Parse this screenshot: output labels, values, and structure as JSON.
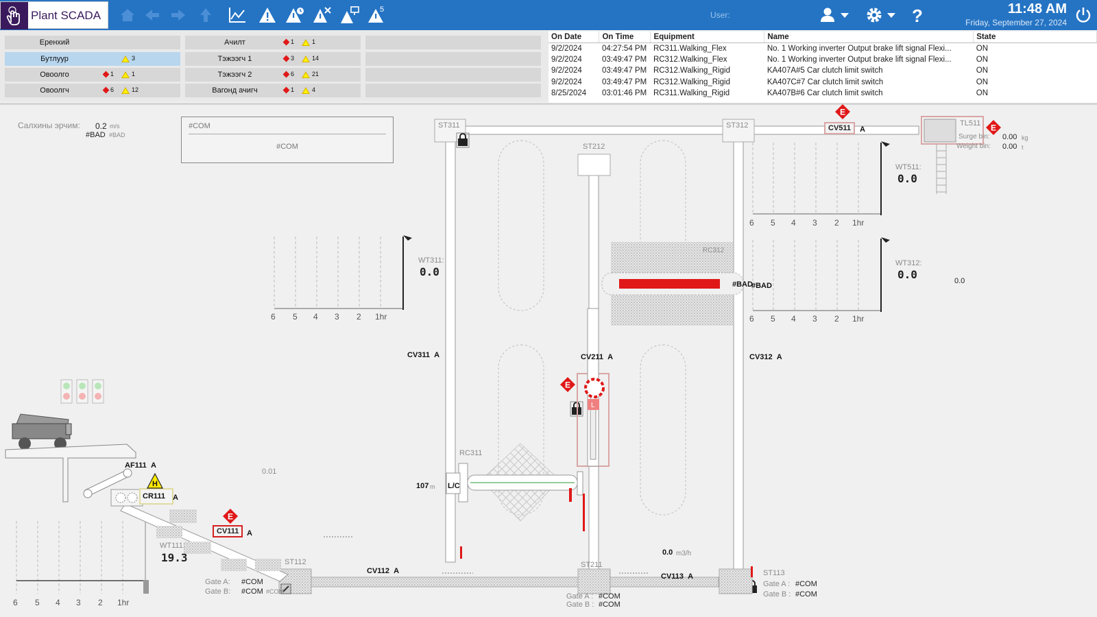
{
  "header": {
    "app_title": "Plant SCADA",
    "user_label": "User:",
    "time": "11:48 AM",
    "date": "Friday, September 27, 2024",
    "toolbar_icons": [
      "home-icon",
      "back-icon",
      "forward-icon",
      "up-icon",
      "trend-icon",
      "alarm-icon",
      "alarm-shelved-icon",
      "alarm-disabled-icon",
      "alarm-network-icon",
      "alarm-count-icon"
    ],
    "alarm_count_badge": "5",
    "colors": {
      "bar": "#2574c4",
      "logo": "#3a1a5c"
    }
  },
  "summary": {
    "col1": [
      {
        "name": "Еренхий",
        "red": "",
        "yellow": ""
      },
      {
        "name": "Бутлуур",
        "red": "",
        "yellow": "3"
      },
      {
        "name": "Овоолго",
        "red": "1",
        "yellow": "1"
      },
      {
        "name": "Овоолгч",
        "red": "6",
        "yellow": "12"
      }
    ],
    "col2": [
      {
        "name": "Ачилт",
        "red": "1",
        "yellow": "1"
      },
      {
        "name": "Тэжээгч 1",
        "red": "3",
        "yellow": "14"
      },
      {
        "name": "Тэжээгч 2",
        "red": "6",
        "yellow": "21"
      },
      {
        "name": "Вагонд ачигч",
        "red": "1",
        "yellow": "4"
      }
    ]
  },
  "alarms": {
    "headers": [
      "On Date",
      "On Time",
      "Equipment",
      "Name",
      "State"
    ],
    "rows": [
      [
        "9/2/2024",
        "04:27:54 PM",
        "RC311.Walking_Flex",
        "No. 1 Working inverter Output brake lift signal Flexi...",
        "ON"
      ],
      [
        "9/2/2024",
        "03:49:47 PM",
        "RC312.Walking_Flex",
        "No. 1 Working inverter Output brake lift signal Flexi...",
        "ON"
      ],
      [
        "9/2/2024",
        "03:49:47 PM",
        "RC312.Walking_Rigid",
        "KA407A#5 Car clutch limit switch",
        "ON"
      ],
      [
        "9/2/2024",
        "03:49:47 PM",
        "RC312.Walking_Rigid",
        "KA407C#7 Car clutch limit switch",
        "ON"
      ],
      [
        "8/25/2024",
        "03:01:46 PM",
        "RC311.Walking_Rigid",
        "KA407B#6 Car clutch limit switch",
        "ON"
      ]
    ]
  },
  "mimic": {
    "speed_label": "Салхины эрчим:",
    "speed_value": "0.2",
    "speed_unit": "m/s",
    "speed_bad": "#BAD",
    "speed_bad2": "#BAD",
    "com_header": "#COM",
    "com_body": "#COM",
    "stations": [
      "ST311",
      "ST312",
      "ST212",
      "ST112",
      "ST211",
      "ST113"
    ],
    "conveyors": {
      "cv511": "CV511",
      "cv511_state": "A",
      "cv311": "CV311",
      "cv311_state": "A",
      "cv312": "CV312",
      "cv312_state": "A",
      "cv211": "CV211",
      "cv211_state": "A",
      "cv111": "CV111",
      "cv111_state": "A",
      "cv112": "CV112",
      "cv112_state": "A",
      "cv113": "CV113",
      "cv113_state": "A",
      "af111": "AF111",
      "af111_state": "A",
      "cr111": "CR111",
      "cr111_state": "A"
    },
    "tl511": {
      "name": "TL511",
      "surge_label": "Surge bin:",
      "surge_value": "0.00",
      "surge_unit": "kg",
      "weight_label": "Weight bin:",
      "weight_value": "0.00",
      "weight_unit": "t"
    },
    "weighers": {
      "wt311": {
        "name": "WT311:",
        "value": "0.0"
      },
      "wt511": {
        "name": "WT511:",
        "value": "0.0"
      },
      "wt312": {
        "name": "WT312:",
        "value": "0.0"
      },
      "wt111": {
        "name": "WT111:",
        "value": "19.3"
      }
    },
    "trend_ticks": [
      "6",
      "5",
      "4",
      "3",
      "2",
      "1hr"
    ],
    "rc312": "RC312",
    "rc311": "RC311",
    "rc312_bad1": "#BAD",
    "rc312_bad2": "#BAD",
    "right_value": "0.0",
    "rc311_position": "107",
    "rc311_position_unit": "m",
    "rc311_mode": "L/C",
    "rc211_lock": "L",
    "af_value": "0.01",
    "flow_value": "0.0",
    "flow_unit": "m3/h",
    "gate_a_label": "Gate A:",
    "gate_b_label": "Gate B:",
    "gate_a_value": "#COM",
    "gate_b_value": "#COM",
    "gate_b_extra": "#COM",
    "gate_a_label_st211": "Gate A :",
    "gate_b_label_st211": "Gate B :",
    "gate_a_value_st211": "#COM",
    "gate_b_value_st211": "#COM",
    "gate_a_label_st113": "Gate A :",
    "gate_b_label_st113": "Gate B :",
    "gate_a_value_st113": "#COM",
    "gate_b_value_st113": "#COM",
    "alarm_badge_e": "E",
    "alarm_badge_h": "H"
  }
}
